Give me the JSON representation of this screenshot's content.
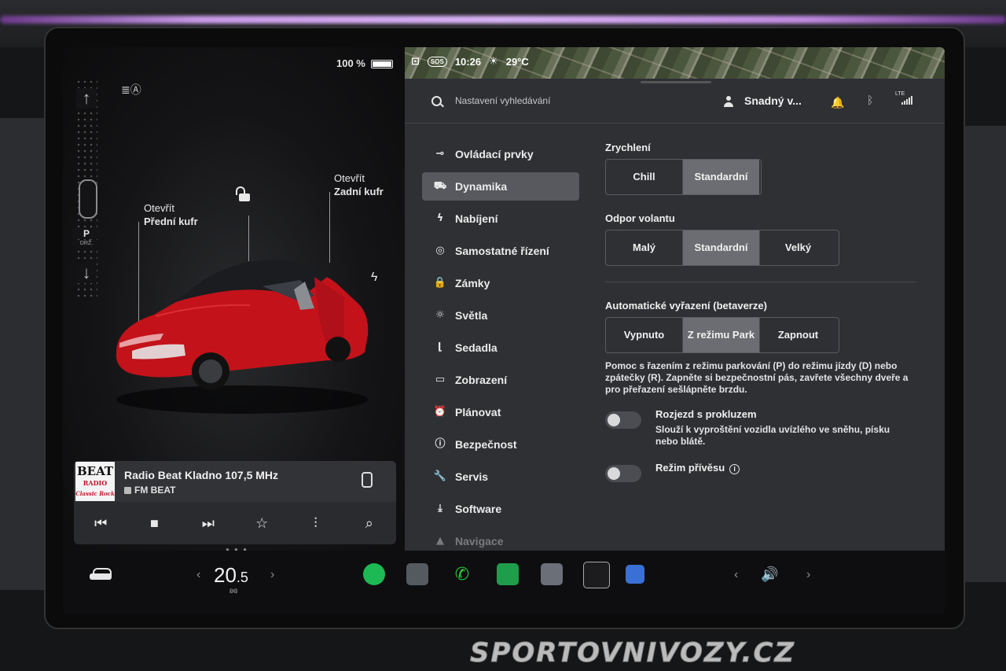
{
  "status": {
    "battery": "100 %",
    "time": "10:26",
    "temperature": "29°C",
    "sos": "SOS"
  },
  "gear": {
    "current": "P",
    "subtext": "DRŽ."
  },
  "car": {
    "frunk": {
      "line1": "Otevřít",
      "line2": "Přední kufr"
    },
    "trunk": {
      "line1": "Otevřít",
      "line2": "Zadní kufr"
    }
  },
  "media": {
    "logo_line1": "BEAT",
    "logo_line2": "RADIO",
    "logo_line3": "Classic Rock",
    "station": "Radio Beat Kladno 107,5 MHz",
    "source": "FM BEAT",
    "controls": [
      "⏮",
      "■",
      "⏭",
      "☆",
      "⫶",
      "⌕"
    ]
  },
  "header": {
    "search_placeholder": "Nastavení vyhledávání",
    "user": "Snadný v..."
  },
  "menu": [
    {
      "label": "Ovládací prvky",
      "icon": "⊸",
      "name": "controls"
    },
    {
      "label": "Dynamika",
      "icon": "⛟",
      "name": "dynamics",
      "active": true
    },
    {
      "label": "Nabíjení",
      "icon": "ϟ",
      "name": "charging"
    },
    {
      "label": "Samostatné řízení",
      "icon": "◎",
      "name": "autopilot"
    },
    {
      "label": "Zámky",
      "icon": "🔒",
      "name": "locks"
    },
    {
      "label": "Světla",
      "icon": "☼",
      "name": "lights"
    },
    {
      "label": "Sedadla",
      "icon": "⌊",
      "name": "seats"
    },
    {
      "label": "Zobrazení",
      "icon": "▭",
      "name": "display"
    },
    {
      "label": "Plánovat",
      "icon": "⏰",
      "name": "schedule"
    },
    {
      "label": "Bezpečnost",
      "icon": "ⓘ",
      "name": "safety"
    },
    {
      "label": "Servis",
      "icon": "🔧",
      "name": "service"
    },
    {
      "label": "Software",
      "icon": "⤓",
      "name": "software"
    },
    {
      "label": "Navigace",
      "icon": "▲",
      "name": "navigation"
    }
  ],
  "acceleration": {
    "title": "Zrychlení",
    "options": [
      "Chill",
      "Standardní"
    ],
    "selected": 1
  },
  "steering": {
    "title": "Odpor volantu",
    "options": [
      "Malý",
      "Standardní",
      "Velký"
    ],
    "selected": 1
  },
  "autoshift": {
    "title": "Automatické vyřazení (betaverze)",
    "options": [
      "Vypnuto",
      "Z režimu Park",
      "Zapnout"
    ],
    "selected": 1,
    "description": "Pomoc s řazením z režimu parkování (P) do režimu jízdy (D) nebo zpátečky (R). Zapněte si bezpečnostní pás, zavřete všechny dveře a pro přeřazení sešlápněte brzdu."
  },
  "slip_start": {
    "label": "Rozjezd s prokluzem",
    "description": "Slouží k vyproštění vozidla uvízlého ve sněhu, písku nebo blátě.",
    "enabled": false
  },
  "trailer_mode": {
    "label": "Režim přívěsu",
    "enabled": false
  },
  "dock": {
    "temp_main": "20",
    "temp_decimal": ".5"
  },
  "watermark": "SPORTOVNIVOZY.CZ"
}
